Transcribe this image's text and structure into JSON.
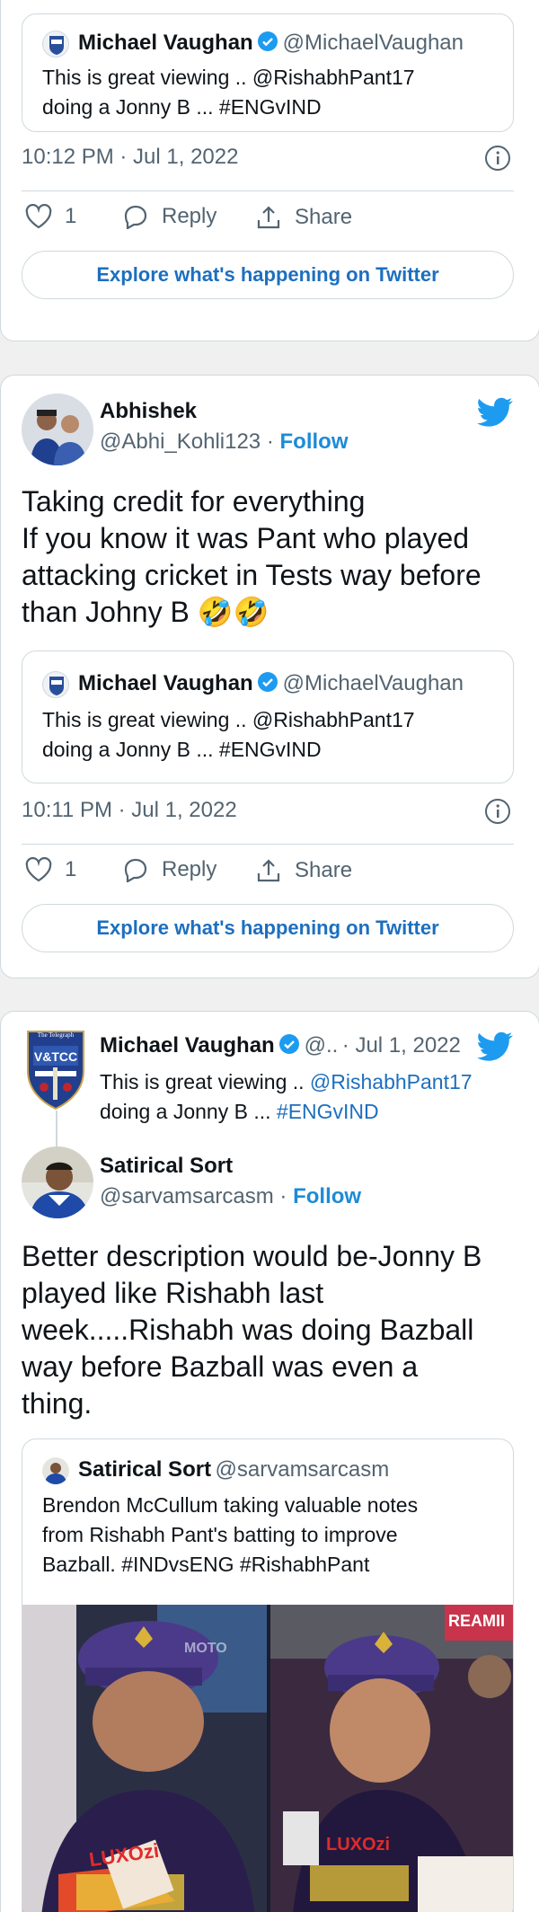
{
  "card1": {
    "quote": {
      "name": "Michael Vaughan",
      "handle": "@MichaelVaughan",
      "text_line1": "This is great viewing .. @RishabhPant17",
      "text_line2": "doing a Jonny B ... #ENGvIND"
    },
    "timestamp": "10:12 PM · Jul 1, 2022",
    "like_count": "1",
    "reply_label": "Reply",
    "share_label": "Share",
    "explore_label": "Explore what's happening on Twitter"
  },
  "card2": {
    "author": {
      "name": "Abhishek",
      "handle": "@Abhi_Kohli123",
      "follow": "Follow"
    },
    "text_lines": [
      "Taking credit for everything",
      "If you know it was Pant who played",
      "attacking cricket in Tests way before",
      "than Johny B 🤣🤣"
    ],
    "quote": {
      "name": "Michael Vaughan",
      "handle": "@MichaelVaughan",
      "text_line1": "This is great viewing .. @RishabhPant17",
      "text_line2": "doing a Jonny B ... #ENGvIND"
    },
    "timestamp": "10:11 PM · Jul 1, 2022",
    "like_count": "1",
    "reply_label": "Reply",
    "share_label": "Share",
    "explore_label": "Explore what's happening on Twitter"
  },
  "card3": {
    "parent": {
      "name": "Michael Vaughan",
      "handle": "@..",
      "date": "· Jul 1, 2022",
      "text_prefix": "This is great viewing .. ",
      "mention": "@RishabhPant17",
      "text_line2_prefix": "doing a Jonny B ... ",
      "hashtag": "#ENGvIND",
      "badge_top": "The Telegraph",
      "badge_text": "V&TCC"
    },
    "author": {
      "name": "Satirical Sort",
      "handle": "@sarvamsarcasm",
      "follow": "Follow"
    },
    "text_lines": [
      "Better description would be-Jonny B",
      "played like Rishabh last",
      "week.....Rishabh was doing Bazball",
      "way before Bazball was even a",
      "thing."
    ],
    "quote": {
      "name": "Satirical Sort",
      "handle": "@sarvamsarcasm",
      "text_lines": [
        "Brendon McCullum taking valuable notes",
        "from Rishabh Pant's batting to improve",
        "Bazball. #INDvsENG #RishabhPant"
      ]
    },
    "media": {
      "left_sponsor": "LUXOzi",
      "right_sponsor": "LUXOzi",
      "sign_right": "REAMII",
      "sign_left": "MOTO"
    }
  },
  "colors": {
    "twitter_blue": "#1d9bf0",
    "link": "#1d6fbf",
    "border": "#cfd9de",
    "muted": "#536471"
  }
}
